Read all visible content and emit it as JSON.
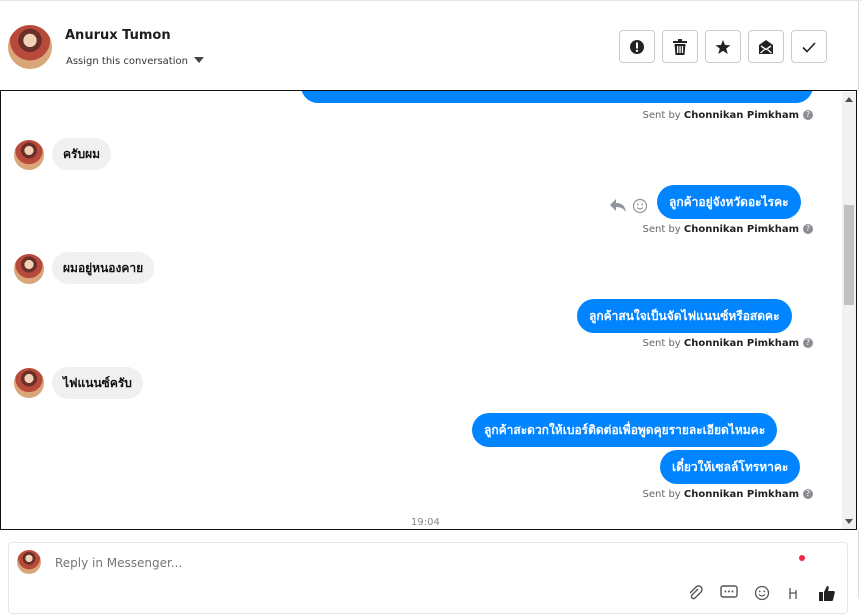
{
  "header": {
    "contact_name": "Anurux Tumon",
    "assign_label": "Assign this conversation",
    "actions": [
      {
        "name": "mark-spam-button",
        "icon": "exclamation-circle-icon"
      },
      {
        "name": "delete-button",
        "icon": "trash-icon"
      },
      {
        "name": "star-button",
        "icon": "star-icon"
      },
      {
        "name": "mark-unread-button",
        "icon": "envelope-icon"
      },
      {
        "name": "mark-done-button",
        "icon": "check-icon"
      }
    ]
  },
  "messages": {
    "m1": {
      "sent_by_prefix": "Sent by",
      "sender": "Chonnikan Pimkham"
    },
    "m2": {
      "text": "ครับผม"
    },
    "m3": {
      "text": "ลูกค้าอยู่จังหวัดอะไรคะ",
      "sent_by_prefix": "Sent by",
      "sender": "Chonnikan Pimkham"
    },
    "m4": {
      "text": "ผมอยู่หนองคาย"
    },
    "m5": {
      "text": "ลูกค้าสนใจเป็นจัดไฟแนนซ์หรือสดคะ",
      "sent_by_prefix": "Sent by",
      "sender": "Chonnikan Pimkham"
    },
    "m6": {
      "text": "ไฟแนนซ์ครับ"
    },
    "m7": {
      "text": "ลูกค้าสะดวกให้เบอร์ติดต่อเพื่อพูดคุยรายละเอียดไหมคะ"
    },
    "m8": {
      "text": "เดี๋ยวให้เซลล์โทรหาคะ",
      "sent_by_prefix": "Sent by",
      "sender": "Chonnikan Pimkham"
    },
    "timestamp": "19:04"
  },
  "composer": {
    "placeholder": "Reply in Messenger...",
    "tools": [
      "paperclip-icon",
      "saved-reply-icon",
      "emoji-icon",
      "translate-icon",
      "thumbs-up-icon"
    ]
  },
  "colors": {
    "accent": "#0084ff",
    "incoming_bubble": "#f0f0f0",
    "notification": "#f02849"
  }
}
